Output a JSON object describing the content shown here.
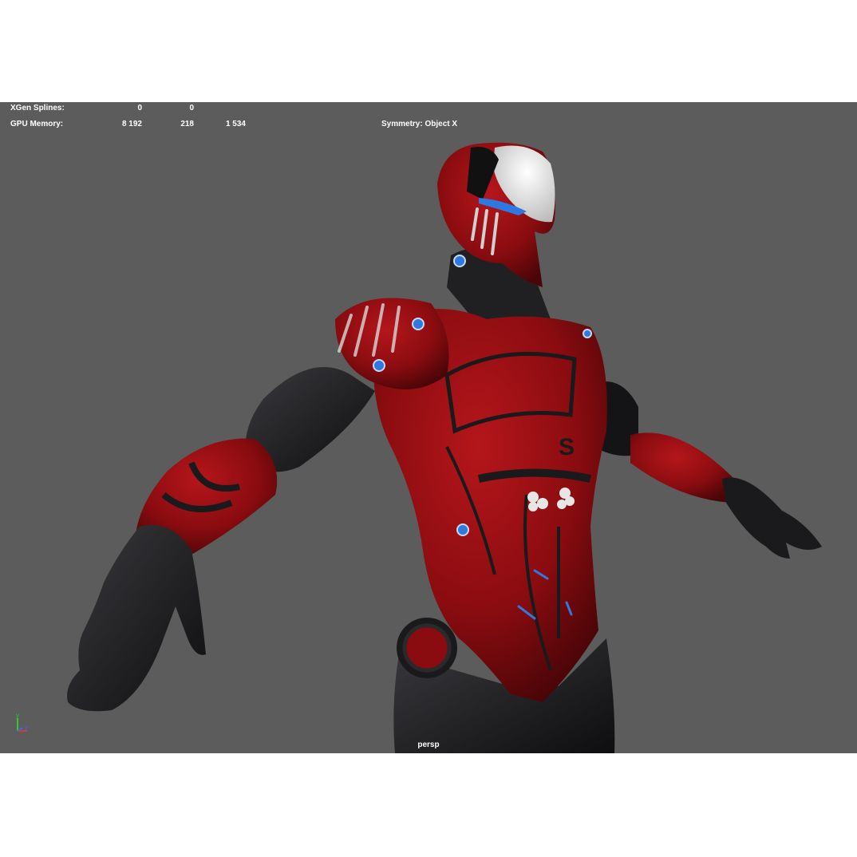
{
  "hud": {
    "xgen_label": "XGen Splines:",
    "xgen_v1": "0",
    "xgen_v2": "0",
    "gpu_label": "GPU Memory:",
    "gpu_v1": "8 192",
    "gpu_v2": "218",
    "gpu_v3": "1 534",
    "symmetry": "Symmetry: Object X"
  },
  "viewport": {
    "camera": "persp",
    "background": "#5c5c5c"
  },
  "axis": {
    "y": "y",
    "z": "z"
  },
  "colors": {
    "suit_red": "#8a0c10",
    "suit_black": "#1b1b1d",
    "accent_blue": "#2f78e0",
    "helmet_white": "#e8e8e8"
  }
}
